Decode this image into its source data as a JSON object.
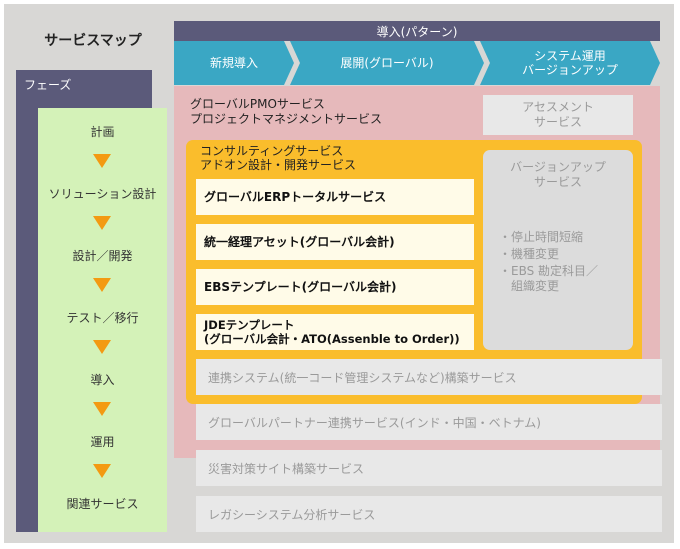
{
  "service_map_title": "サービスマップ",
  "phases": {
    "label": "フェーズ",
    "steps": [
      "計画",
      "ソリューション設計",
      "設計／開発",
      "テスト／移行",
      "導入",
      "運用",
      "関連サービス"
    ]
  },
  "intro": {
    "header": "導入(パターン)",
    "patterns": [
      {
        "label": "新規導入"
      },
      {
        "label": "展開(グローバル)"
      },
      {
        "label": "システム運用\nバージョンアップ"
      }
    ]
  },
  "pmo": {
    "line1": "グローバルPMOサービス",
    "line2": "プロジェクトマネジメントサービス"
  },
  "assessment": "アセスメント\nサービス",
  "consulting": {
    "line1": "コンサルティングサービス",
    "line2": "アドオン設計・開発サービス"
  },
  "solutions": [
    "グローバルERPトータルサービス",
    "統一経理アセット(グローバル会計)",
    "EBSテンプレート(グローバル会計)",
    "JDEテンプレート\n(グローバル会計・ATO(Assenble to Order))"
  ],
  "upgrade": {
    "title": "バージョンアップ\nサービス",
    "bullets": [
      "・停止時間短縮",
      "・機種変更",
      "・EBS 勘定科目／\n　組織変更"
    ]
  },
  "related_services": [
    "連携システム(統一コード管理システムなど)構築サービス",
    "グローバルパートナー連携サービス(インド・中国・ベトナム)",
    "災害対策サイト構築サービス",
    "レガシーシステム分析サービス"
  ],
  "colors": {
    "frame": "#d8d7d5",
    "phase_panel": "#5b5a7a",
    "phase_list": "#d4f2b8",
    "arrow": "#f39a12",
    "pattern_tab": "#3aa7c4",
    "pmo_area": "#e6b9bb",
    "consult_area": "#fabd2c",
    "white_box": "#fffbe8",
    "gray_box": "#e8e8e8"
  }
}
